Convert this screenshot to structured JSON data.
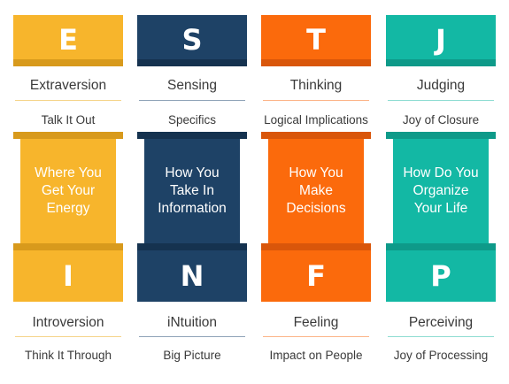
{
  "columns": [
    {
      "top_letter": "E",
      "top_label": "Extraversion",
      "top_sub": "Talk It Out",
      "pillar_text": "Where You Get Your Energy",
      "bottom_letter": "I",
      "bottom_label": "Introversion",
      "bottom_sub": "Think It Through",
      "colors": {
        "main": "#f7b52c",
        "dark": "#d89a1c",
        "rule": "#f5d48a"
      }
    },
    {
      "top_letter": "S",
      "top_label": "Sensing",
      "top_sub": "Specifics",
      "pillar_text": "How You Take In Information",
      "bottom_letter": "N",
      "bottom_label": "iNtuition",
      "bottom_sub": "Big Picture",
      "colors": {
        "main": "#1e4266",
        "dark": "#15324f",
        "rule": "#8fa3b8"
      }
    },
    {
      "top_letter": "T",
      "top_label": "Thinking",
      "top_sub": "Logical Implications",
      "pillar_text": "How You Make Decisions",
      "bottom_letter": "F",
      "bottom_label": "Feeling",
      "bottom_sub": "Impact on People",
      "colors": {
        "main": "#fb6a0c",
        "dark": "#d9560a",
        "rule": "#fcb488"
      }
    },
    {
      "top_letter": "J",
      "top_label": "Judging",
      "top_sub": "Joy of Closure",
      "pillar_text": "How Do You Organize Your Life",
      "bottom_letter": "P",
      "bottom_label": "Perceiving",
      "bottom_sub": "Joy of Processing",
      "colors": {
        "main": "#13b8a4",
        "dark": "#0e9a89",
        "rule": "#8edcd2"
      }
    }
  ]
}
